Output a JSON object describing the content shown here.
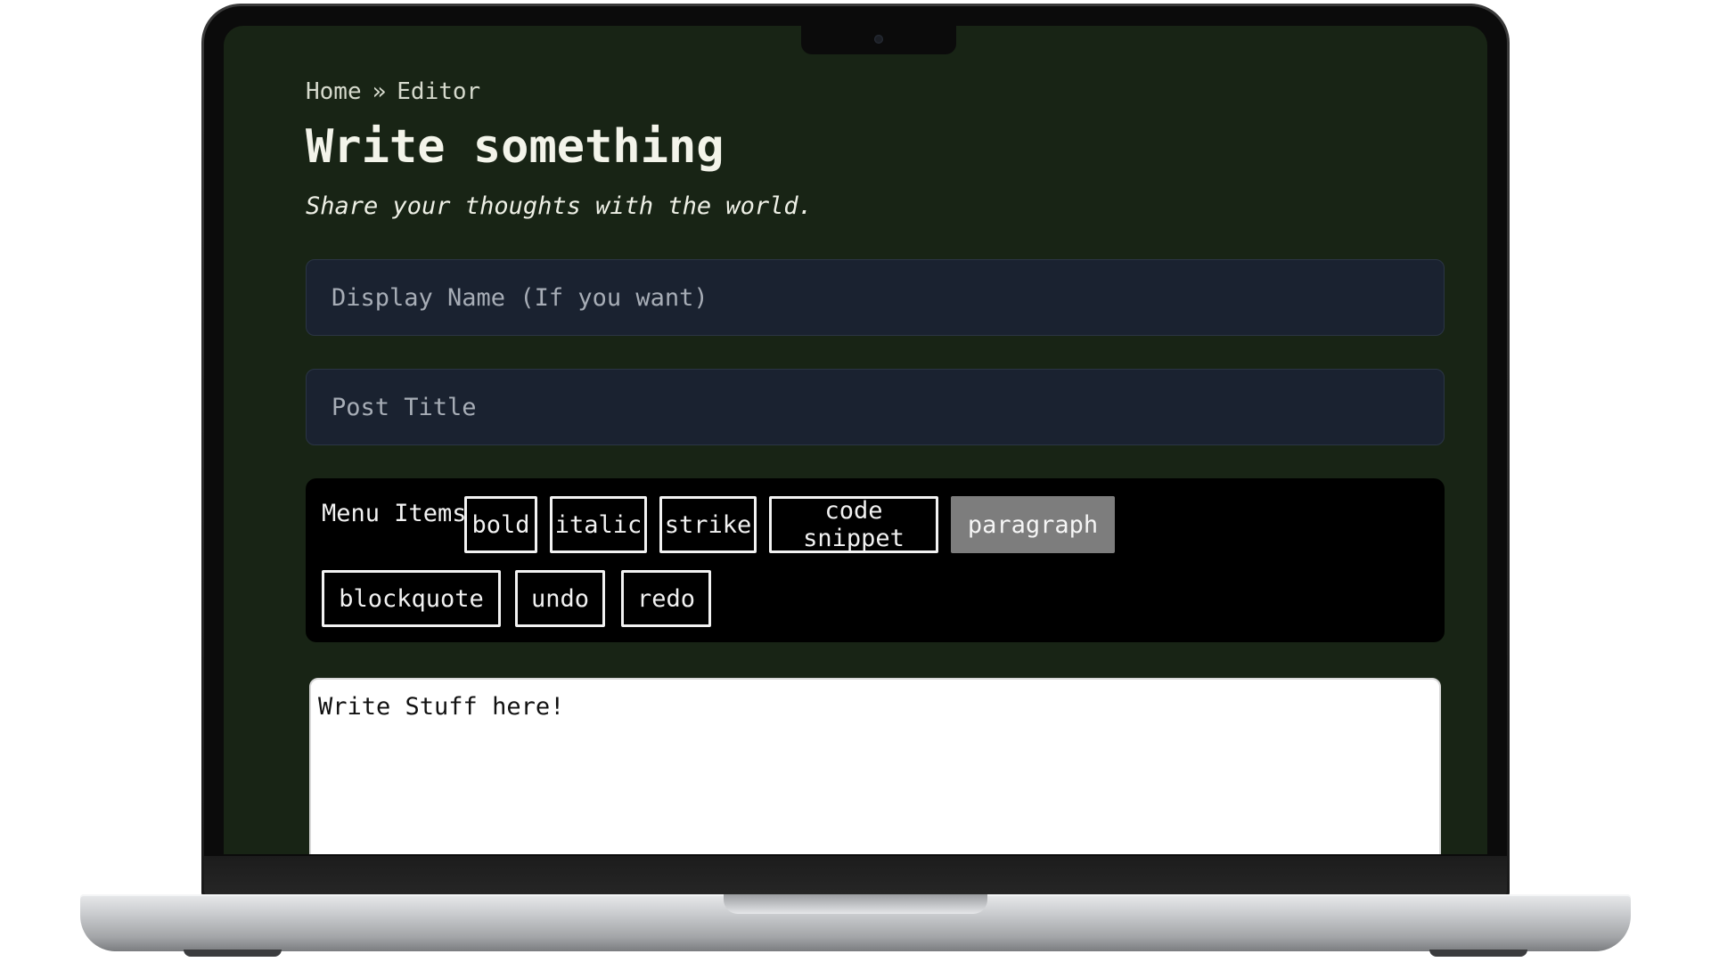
{
  "breadcrumb": {
    "home": "Home",
    "separator": "»",
    "current": "Editor"
  },
  "header": {
    "title": "Write something",
    "subtitle": "Share your thoughts with the world."
  },
  "form": {
    "display_name_placeholder": "Display Name (If you want)",
    "display_name_value": "",
    "post_title_placeholder": "Post Title",
    "post_title_value": ""
  },
  "menu": {
    "label": "Menu Items:",
    "items": [
      {
        "label": "bold",
        "active": false
      },
      {
        "label": "italic",
        "active": false
      },
      {
        "label": "strike",
        "active": false
      },
      {
        "label": "code snippet",
        "active": false
      },
      {
        "label": "paragraph",
        "active": true
      },
      {
        "label": "blockquote",
        "active": false
      },
      {
        "label": "undo",
        "active": false
      },
      {
        "label": "redo",
        "active": false
      }
    ]
  },
  "editor": {
    "content": "Write Stuff here!"
  },
  "colors": {
    "screen_background": "#182415",
    "input_background": "#1a2230",
    "menu_background": "#000000",
    "active_button": "#7d7d7d",
    "text": "#eef0e6"
  }
}
